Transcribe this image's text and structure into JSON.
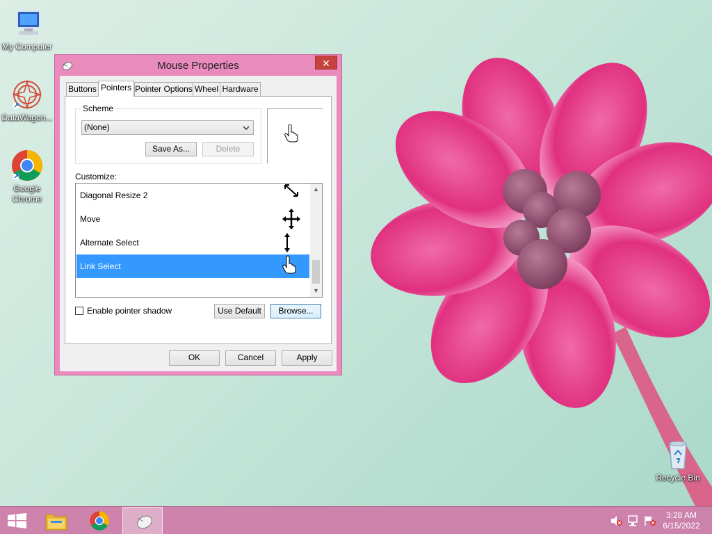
{
  "desktop": {
    "icons": [
      {
        "label": "My Computer"
      },
      {
        "label": "DataWagon..."
      },
      {
        "label": "Google Chrome"
      },
      {
        "label": "Recycle Bin"
      }
    ]
  },
  "dialog": {
    "title": "Mouse Properties",
    "close_glyph": "✕",
    "tabs": [
      {
        "label": "Buttons"
      },
      {
        "label": "Pointers",
        "active": true
      },
      {
        "label": "Pointer Options"
      },
      {
        "label": "Wheel"
      },
      {
        "label": "Hardware"
      }
    ],
    "scheme": {
      "label": "Scheme",
      "selected": "(None)",
      "save_as_label": "Save As...",
      "delete_label": "Delete"
    },
    "customize_label": "Customize:",
    "pointers": [
      {
        "name": "Diagonal Resize 2",
        "icon": "diagonal-resize-icon"
      },
      {
        "name": "Move",
        "icon": "move-icon"
      },
      {
        "name": "Alternate Select",
        "icon": "vertical-resize-icon"
      },
      {
        "name": "Link Select",
        "icon": "hand-pointer-icon",
        "selected": true
      }
    ],
    "enable_shadow_label": "Enable pointer shadow",
    "enable_shadow_checked": false,
    "use_default_label": "Use Default",
    "browse_label": "Browse...",
    "ok_label": "OK",
    "cancel_label": "Cancel",
    "apply_label": "Apply"
  },
  "taskbar": {
    "time": "3:28 AM",
    "date": "6/15/2022"
  },
  "colors": {
    "accent_pink": "#e98bbd",
    "selection_blue": "#3399ff",
    "taskbar": "#ce7ba8"
  }
}
